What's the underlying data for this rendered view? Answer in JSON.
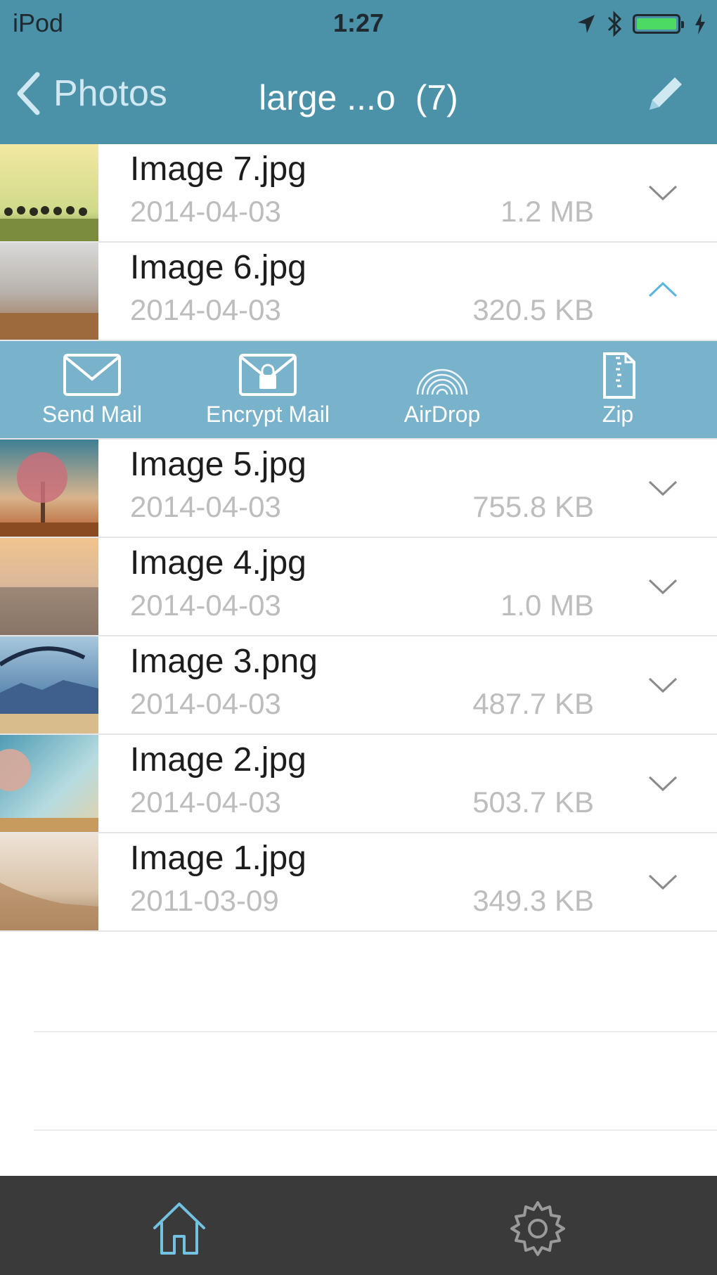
{
  "status_bar": {
    "device": "iPod",
    "time": "1:27"
  },
  "nav": {
    "back_label": "Photos",
    "title": "large ...o",
    "count": "(7)"
  },
  "files": [
    {
      "name": "Image 7.jpg",
      "date": "2014-04-03",
      "size": "1.2 MB",
      "chevron": "chevron-down-icon"
    },
    {
      "name": "Image 6.jpg",
      "date": "2014-04-03",
      "size": "320.5 KB",
      "chevron": "chevron-up-icon"
    },
    {
      "name": "Image 5.jpg",
      "date": "2014-04-03",
      "size": "755.8 KB",
      "chevron": "chevron-down-icon"
    },
    {
      "name": "Image 4.jpg",
      "date": "2014-04-03",
      "size": "1.0 MB",
      "chevron": "chevron-down-icon"
    },
    {
      "name": "Image 3.png",
      "date": "2014-04-03",
      "size": "487.7 KB",
      "chevron": "chevron-down-icon"
    },
    {
      "name": "Image 2.jpg",
      "date": "2014-04-03",
      "size": "503.7 KB",
      "chevron": "chevron-down-icon"
    },
    {
      "name": "Image 1.jpg",
      "date": "2011-03-09",
      "size": "349.3 KB",
      "chevron": "chevron-down-icon"
    }
  ],
  "actions": [
    {
      "label": "Send Mail",
      "icon": "envelope-icon"
    },
    {
      "label": "Encrypt Mail",
      "icon": "lock-envelope-icon"
    },
    {
      "label": "AirDrop",
      "icon": "airdrop-icon"
    },
    {
      "label": "Zip",
      "icon": "zip-file-icon"
    }
  ],
  "tabbar": {
    "home_icon": "home-icon",
    "settings_icon": "gear-icon"
  },
  "colors": {
    "header": "#4b91a8",
    "action_bar": "#78b2cb",
    "tab_bar": "#3a3a3a",
    "battery": "#4cd964",
    "accent": "#5bb6dd"
  }
}
